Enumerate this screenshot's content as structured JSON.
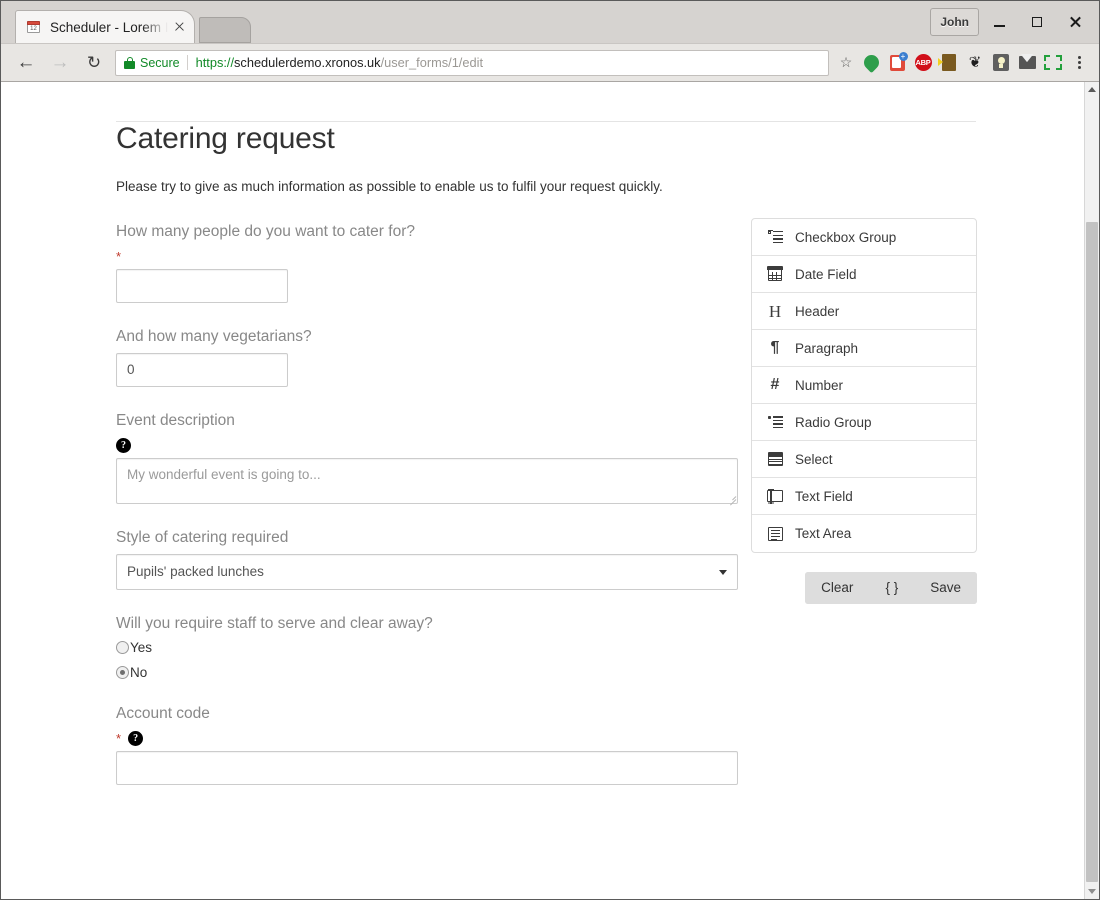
{
  "browser": {
    "tab": {
      "favicon": "calendar-icon",
      "favicon_number": "12",
      "title": "Scheduler - Lorem I"
    },
    "new_tab_label": "",
    "window": {
      "user_button": "John",
      "minimize": "minimize-icon",
      "maximize": "maximize-icon",
      "close": "close-icon"
    },
    "nav": {
      "back": "back-arrow-icon",
      "forward": "forward-arrow-icon",
      "reload": "reload-icon",
      "security_label": "Secure",
      "url_scheme": "https://",
      "url_host": "schedulerdemo.xronos.uk",
      "url_path": "/user_forms/1/edit",
      "bookmark": "star-icon"
    },
    "extensions": [
      {
        "name": "green-dot-icon"
      },
      {
        "name": "red-book-add-icon"
      },
      {
        "name": "adblock-plus-icon",
        "label": "ABP"
      },
      {
        "name": "door-icon"
      },
      {
        "name": "gnome-foot-icon",
        "glyph": "❦"
      },
      {
        "name": "lightbulb-icon"
      },
      {
        "name": "mail-icon"
      },
      {
        "name": "screenshot-frame-icon"
      },
      {
        "name": "chrome-menu-icon"
      }
    ]
  },
  "form": {
    "title": "Catering request",
    "intro": "Please try to give as much information as possible to enable us to fulfil your request quickly.",
    "fields": [
      {
        "type": "number",
        "label": "How many people do you want to cater for?",
        "required": true,
        "help": false,
        "value": "",
        "width": "short"
      },
      {
        "type": "number",
        "label": "And how many vegetarians?",
        "required": false,
        "help": false,
        "value": "0",
        "width": "short"
      },
      {
        "type": "textarea",
        "label": "Event description",
        "required": false,
        "help": true,
        "value": "",
        "placeholder": "My wonderful event is going to..."
      },
      {
        "type": "select",
        "label": "Style of catering required",
        "required": false,
        "help": false,
        "value": "Pupils' packed lunches"
      },
      {
        "type": "radio",
        "label": "Will you require staff to serve and clear away?",
        "required": false,
        "help": false,
        "options": [
          {
            "label": "Yes",
            "selected": false
          },
          {
            "label": "No",
            "selected": true
          }
        ]
      },
      {
        "type": "text",
        "label": "Account code",
        "required": true,
        "help": true,
        "value": "",
        "width": "full"
      }
    ],
    "required_marker": "*",
    "help_marker": "?"
  },
  "palette": {
    "items": [
      {
        "icon": "checkbox-group-icon",
        "label": "Checkbox Group"
      },
      {
        "icon": "calendar-icon",
        "label": "Date Field"
      },
      {
        "icon": "header-h-icon",
        "label": "Header",
        "glyph": "H"
      },
      {
        "icon": "paragraph-icon",
        "label": "Paragraph",
        "glyph": "¶"
      },
      {
        "icon": "number-hash-icon",
        "label": "Number",
        "glyph": "#"
      },
      {
        "icon": "radio-group-icon",
        "label": "Radio Group"
      },
      {
        "icon": "select-icon",
        "label": "Select"
      },
      {
        "icon": "text-field-icon",
        "label": "Text Field"
      },
      {
        "icon": "text-area-icon",
        "label": "Text Area"
      }
    ],
    "actions": [
      {
        "name": "clear-button",
        "label": "Clear"
      },
      {
        "name": "json-button",
        "label": "{ }"
      },
      {
        "name": "save-button",
        "label": "Save"
      }
    ]
  },
  "colors": {
    "required": "#c0392b",
    "secure": "#128a28",
    "label": "#888888",
    "button_group_bg": "#dddddd"
  }
}
